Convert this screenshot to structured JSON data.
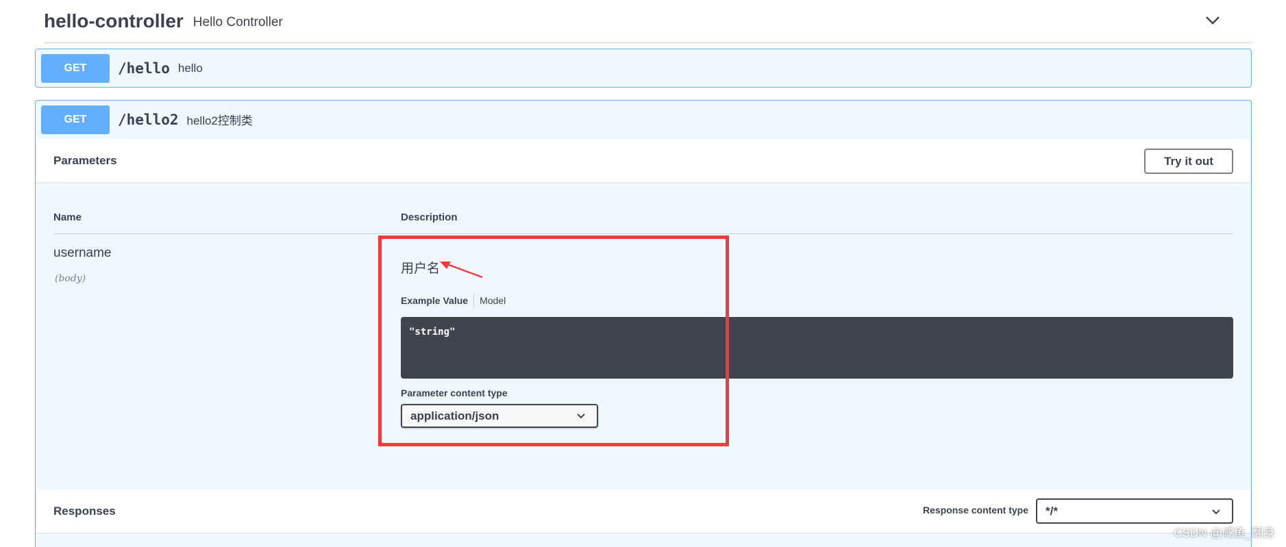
{
  "tag": {
    "name": "hello-controller",
    "description": "Hello Controller"
  },
  "operations": [
    {
      "method": "GET",
      "path": "/hello",
      "summary": "hello"
    },
    {
      "method": "GET",
      "path": "/hello2",
      "summary": "hello2控制类"
    }
  ],
  "parameters_section": {
    "title": "Parameters",
    "try_button": "Try it out",
    "columns": {
      "name": "Name",
      "description": "Description"
    },
    "param": {
      "name": "username",
      "in": "(body)",
      "description": "用户名",
      "tabs": {
        "example": "Example Value",
        "model": "Model"
      },
      "example_value": "\"string\"",
      "content_type_label": "Parameter content type",
      "content_type_selected": "application/json"
    }
  },
  "responses_section": {
    "title": "Responses",
    "content_type_label": "Response content type",
    "content_type_selected": "*/*"
  },
  "watermark": "CSDN @咸鱼_翻身",
  "colors": {
    "get_accent": "#61affe",
    "annotation_red": "#f23a3d",
    "code_bg": "#41444e"
  },
  "icons": {
    "tag_toggle": "chevron-down-icon",
    "select_caret": "chevron-down-icon",
    "annotation": "red-arrow"
  }
}
